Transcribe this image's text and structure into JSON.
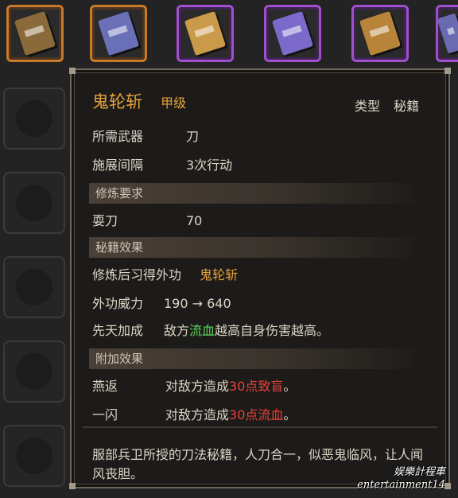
{
  "inventory": {
    "books": [
      {
        "icon": "brown-book-icon",
        "color": "#8a6a3a",
        "frame": "orange"
      },
      {
        "icon": "blue-book-icon",
        "color": "#6a70b8",
        "frame": "orange"
      },
      {
        "icon": "tan-book-icon",
        "color": "#c99a4a",
        "frame": "purple"
      },
      {
        "icon": "violet-book-icon",
        "color": "#7b6ac9",
        "frame": "purple"
      },
      {
        "icon": "gold-book-icon",
        "color": "#b8843a",
        "frame": "purple"
      },
      {
        "icon": "partial-book-icon",
        "color": "#6a6ab0",
        "frame": "purple"
      }
    ]
  },
  "tooltip": {
    "name": "鬼轮斩",
    "grade": "甲级",
    "type_label": "类型",
    "type_value": "秘籍",
    "weapon_label": "所需武器",
    "weapon_value": "刀",
    "interval_label": "施展间隔",
    "interval_value": "3次行动",
    "req_header": "修炼要求",
    "req_skill_label": "耍刀",
    "req_skill_value": "70",
    "effect_header": "秘籍效果",
    "learn_label": "修炼后习得外功",
    "learn_value": "鬼轮斩",
    "power_label": "外功威力",
    "power_value": "190 → 640",
    "innate_label": "先天加成",
    "innate_pre": "敌方",
    "innate_key": "流血",
    "innate_post": "越高自身伤害越高。",
    "extra_header": "附加效果",
    "extra1_label": "燕返",
    "extra1_pre": "对敌方造成",
    "extra1_key": "30点致盲",
    "extra1_post": "。",
    "extra2_label": "一闪",
    "extra2_pre": "对敌方造成",
    "extra2_key": "30点流血",
    "extra2_post": "。",
    "description": "服部兵卫所授的刀法秘籍，人刀合一，似恶鬼临风，让人闻风丧胆。"
  },
  "watermark": {
    "line1": "娱樂計程車",
    "line2": "entertainment14"
  }
}
